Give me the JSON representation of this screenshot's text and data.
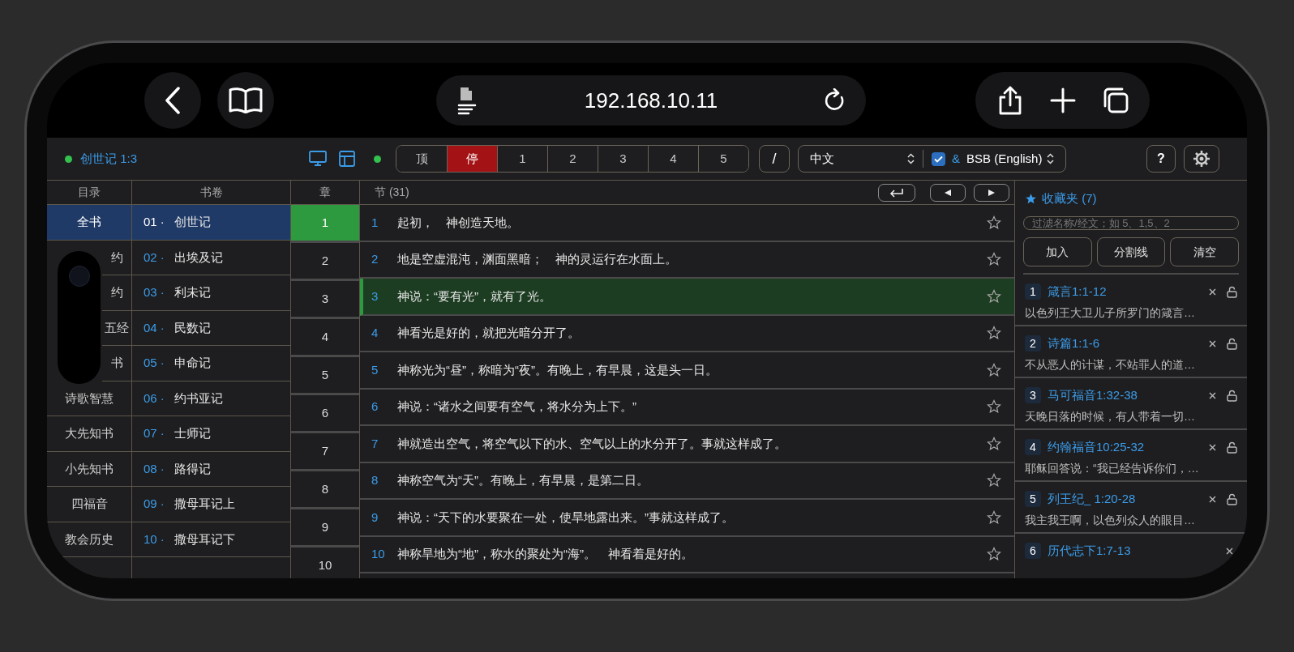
{
  "browser": {
    "url": "192.168.10.11"
  },
  "toolbar": {
    "location": "创世记 1:3",
    "segments": [
      {
        "label": "顶",
        "selected": false
      },
      {
        "label": "停",
        "selected": true
      },
      {
        "label": "1",
        "selected": false
      },
      {
        "label": "2",
        "selected": false
      },
      {
        "label": "3",
        "selected": false
      },
      {
        "label": "4",
        "selected": false
      },
      {
        "label": "5",
        "selected": false
      }
    ],
    "slash": "/",
    "language": "中文",
    "parallel": {
      "checked": true,
      "label": "&"
    },
    "version": "BSB (English)",
    "help": "?"
  },
  "categories": {
    "heading": "目录",
    "items": [
      {
        "label": "全书",
        "selected": true
      },
      {
        "label": "约",
        "selected": false
      },
      {
        "label": "约",
        "selected": false
      },
      {
        "label": "五经",
        "selected": false
      },
      {
        "label": "书",
        "selected": false
      },
      {
        "label": "诗歌智慧",
        "selected": false
      },
      {
        "label": "大先知书",
        "selected": false
      },
      {
        "label": "小先知书",
        "selected": false
      },
      {
        "label": "四福音",
        "selected": false
      },
      {
        "label": "教会历史",
        "selected": false
      }
    ]
  },
  "books": {
    "heading": "书卷",
    "items": [
      {
        "number": "01 ·",
        "name": "创世记",
        "selected": true
      },
      {
        "number": "02 ·",
        "name": "出埃及记",
        "selected": false
      },
      {
        "number": "03 ·",
        "name": "利未记",
        "selected": false
      },
      {
        "number": "04 ·",
        "name": "民数记",
        "selected": false
      },
      {
        "number": "05 ·",
        "name": "申命记",
        "selected": false
      },
      {
        "number": "06 ·",
        "name": "约书亚记",
        "selected": false
      },
      {
        "number": "07 ·",
        "name": "士师记",
        "selected": false
      },
      {
        "number": "08 ·",
        "name": "路得记",
        "selected": false
      },
      {
        "number": "09 ·",
        "name": "撒母耳记上",
        "selected": false
      },
      {
        "number": "10 ·",
        "name": "撒母耳记下",
        "selected": false
      }
    ]
  },
  "chapters": {
    "heading": "章",
    "items": [
      {
        "label": "1",
        "selected": true
      },
      {
        "label": "2",
        "selected": false
      },
      {
        "label": "3",
        "selected": false
      },
      {
        "label": "4",
        "selected": false
      },
      {
        "label": "5",
        "selected": false
      },
      {
        "label": "6",
        "selected": false
      },
      {
        "label": "7",
        "selected": false
      },
      {
        "label": "8",
        "selected": false
      },
      {
        "label": "9",
        "selected": false
      },
      {
        "label": "10",
        "selected": false
      }
    ]
  },
  "verses": {
    "heading": "节 (31)",
    "items": [
      {
        "number": "1",
        "text": "起初，　神创造天地。",
        "selected": false,
        "starred": false
      },
      {
        "number": "2",
        "text": "地是空虚混沌，渊面黑暗；　神的灵运行在水面上。",
        "selected": false,
        "starred": false
      },
      {
        "number": "3",
        "text": "神说：“要有光”，就有了光。",
        "selected": true,
        "starred": false
      },
      {
        "number": "4",
        "text": "神看光是好的，就把光暗分开了。",
        "selected": false,
        "starred": false
      },
      {
        "number": "5",
        "text": "神称光为“昼”，称暗为“夜”。有晚上，有早晨，这是头一日。",
        "selected": false,
        "starred": false
      },
      {
        "number": "6",
        "text": "神说：“诸水之间要有空气，将水分为上下。”",
        "selected": false,
        "starred": false
      },
      {
        "number": "7",
        "text": "神就造出空气，将空气以下的水、空气以上的水分开了。事就这样成了。",
        "selected": false,
        "starred": false
      },
      {
        "number": "8",
        "text": "神称空气为“天”。有晚上，有早晨，是第二日。",
        "selected": false,
        "starred": false
      },
      {
        "number": "9",
        "text": "神说：“天下的水要聚在一处，使旱地露出来。”事就这样成了。",
        "selected": false,
        "starred": false
      },
      {
        "number": "10",
        "text": "神称旱地为“地”，称水的聚处为“海”。　神看着是好的。",
        "selected": false,
        "starred": false
      }
    ]
  },
  "favorites": {
    "title": "收藏夹 (7)",
    "filter_placeholder": "过滤名称/经文；如 5、1,5、2",
    "buttons": [
      "加入",
      "分割线",
      "清空"
    ],
    "items": [
      {
        "number": "1",
        "ref": "箴言1:1-12",
        "snippet": "以色列王大卫儿子所罗门的箴言…",
        "locked": false
      },
      {
        "number": "2",
        "ref": "诗篇1:1-6",
        "snippet": "不从恶人的计谋，不站罪人的道…",
        "locked": false
      },
      {
        "number": "3",
        "ref": "马可福音1:32-38",
        "snippet": "天晚日落的时候，有人带着一切…",
        "locked": false
      },
      {
        "number": "4",
        "ref": "约翰福音10:25-32",
        "snippet": "耶稣回答说：“我已经告诉你们，…",
        "locked": false
      },
      {
        "number": "5",
        "ref": "列王纪_ 1:20-28",
        "snippet": "我主我王啊，以色列众人的眼目…",
        "locked": false
      },
      {
        "number": "6",
        "ref": "历代志下1:7-13"
      }
    ]
  }
}
